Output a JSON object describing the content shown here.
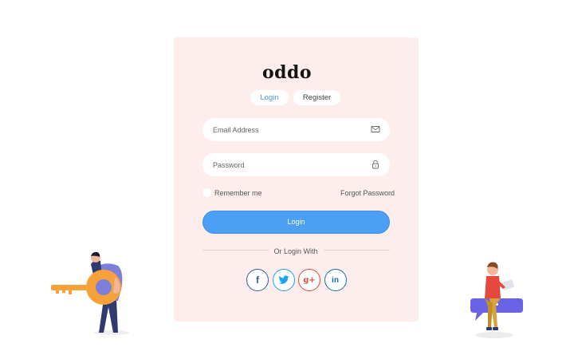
{
  "brand": {
    "logo_text": "oddo"
  },
  "tabs": [
    {
      "label": "Login",
      "active": true
    },
    {
      "label": "Register",
      "active": false
    }
  ],
  "form": {
    "email_placeholder": "Email Address",
    "email_icon": "mail-icon",
    "password_placeholder": "Password",
    "password_icon": "lock-icon",
    "remember_label": "Remember me",
    "forgot_label": "Forgot Password",
    "submit_label": "Login"
  },
  "social": {
    "divider_text": "Or Login With",
    "buttons": [
      {
        "icon": "facebook-icon",
        "glyph": "f",
        "color": "#3b5998"
      },
      {
        "icon": "twitter-icon",
        "glyph": "",
        "color": "#1da1f2"
      },
      {
        "icon": "google-plus-icon",
        "glyph": "g+",
        "color": "#dd4b39"
      },
      {
        "icon": "linkedin-icon",
        "glyph": "in",
        "color": "#0e76a8"
      }
    ]
  },
  "colors": {
    "card_background": "#fdeeed",
    "primary": "#4d9ef5",
    "tab_active_text": "#4a93e8"
  }
}
